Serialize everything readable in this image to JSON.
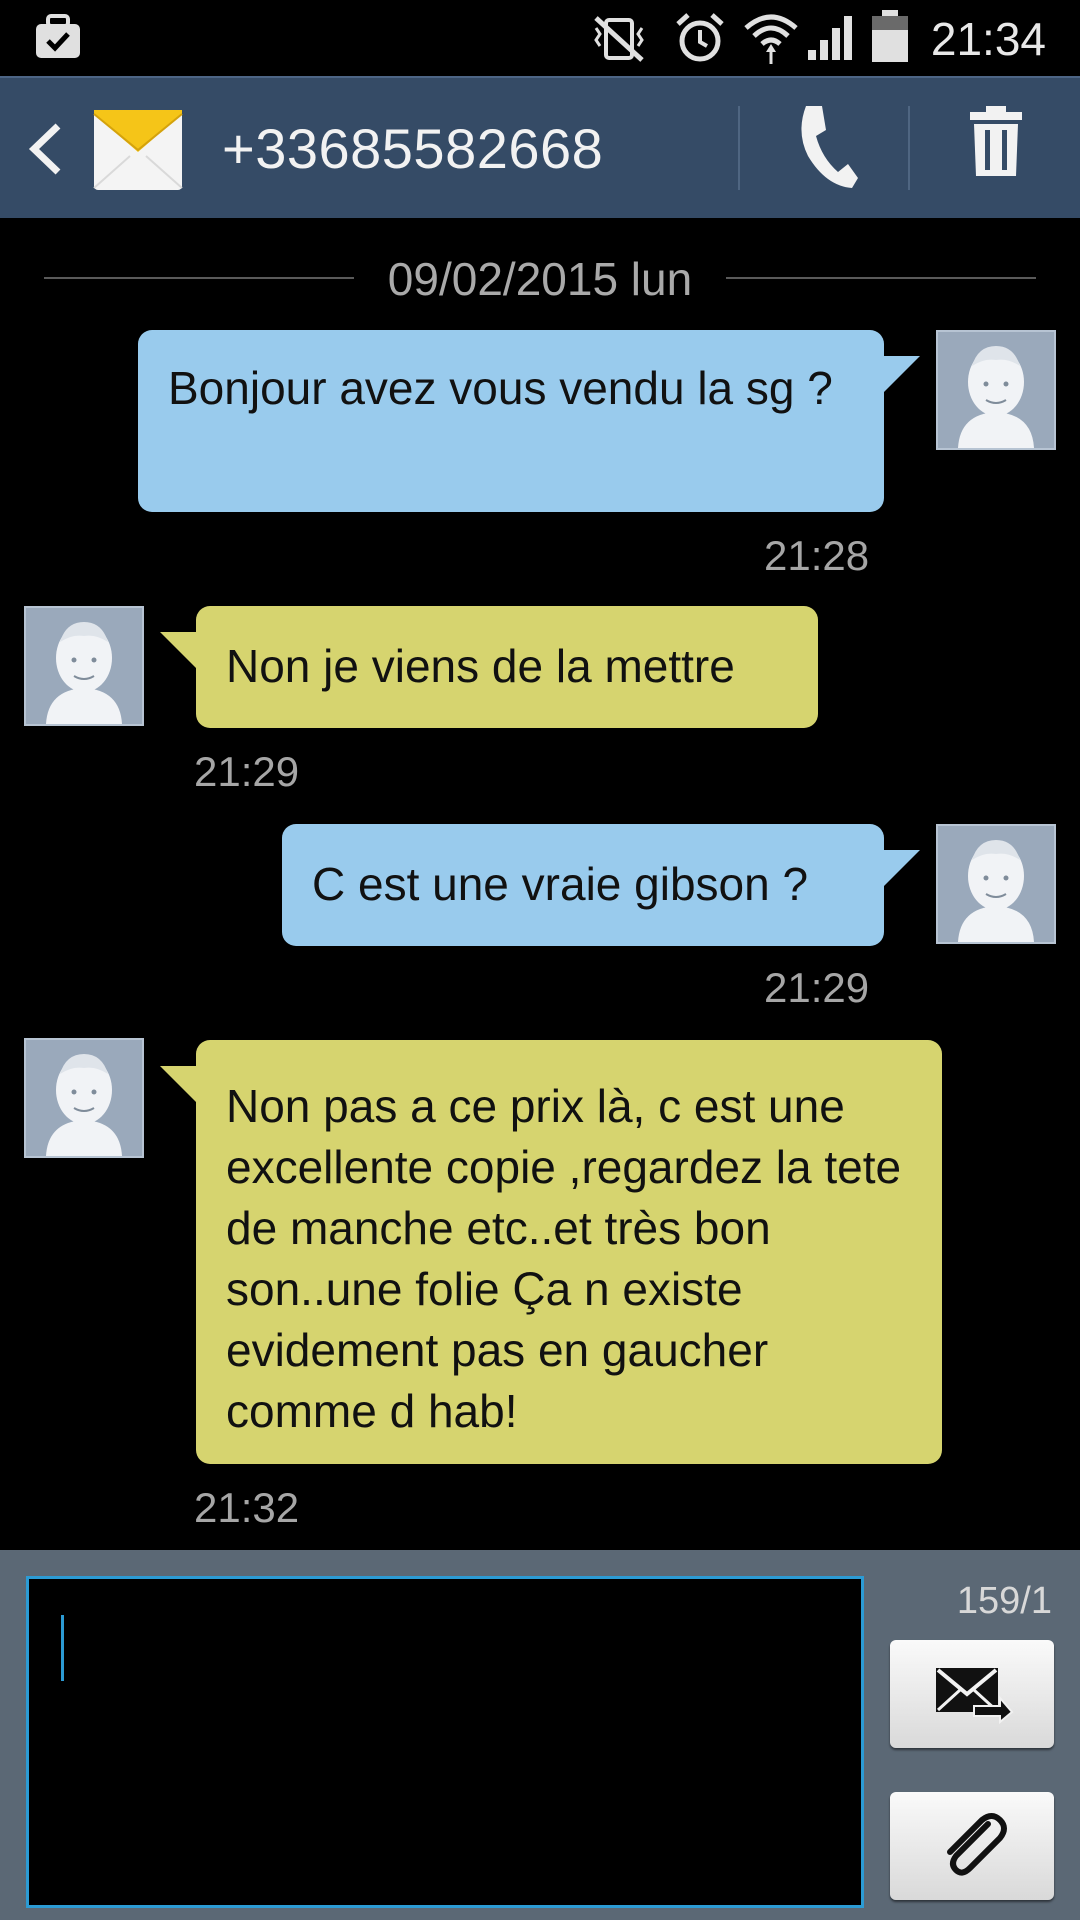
{
  "status_bar": {
    "time": "21:34",
    "icons": [
      "briefcase-check-icon",
      "vibrate-mute-icon",
      "alarm-icon",
      "wifi-icon",
      "signal-icon",
      "battery-icon"
    ]
  },
  "header": {
    "contact": "+33685582668",
    "icons": [
      "back-chevron-icon",
      "envelope-icon",
      "phone-icon",
      "trash-icon"
    ]
  },
  "conversation": {
    "date": "09/02/2015 lun",
    "messages": [
      {
        "dir": "out",
        "text": "Bonjour avez vous vendu la sg ?",
        "time": "21:28"
      },
      {
        "dir": "in",
        "text": "Non je viens de la mettre",
        "time": "21:29"
      },
      {
        "dir": "out",
        "text": "C est une vraie gibson ?",
        "time": "21:29"
      },
      {
        "dir": "in",
        "text": "Non pas a ce prix là, c est une excellente copie ,regardez la tete de manche etc..et très bon son..une folie Ça n existe evidement pas en gaucher comme d hab!",
        "time": "21:32"
      }
    ]
  },
  "composer": {
    "input_value": "",
    "counter": "159/1",
    "icons": [
      "send-icon",
      "paperclip-icon"
    ]
  },
  "colors": {
    "action_bar": "#354b66",
    "outgoing_bubble": "#99cbed",
    "incoming_bubble": "#d6d46f",
    "composer_bg": "#5b6875",
    "accent": "#2c9bd4"
  }
}
